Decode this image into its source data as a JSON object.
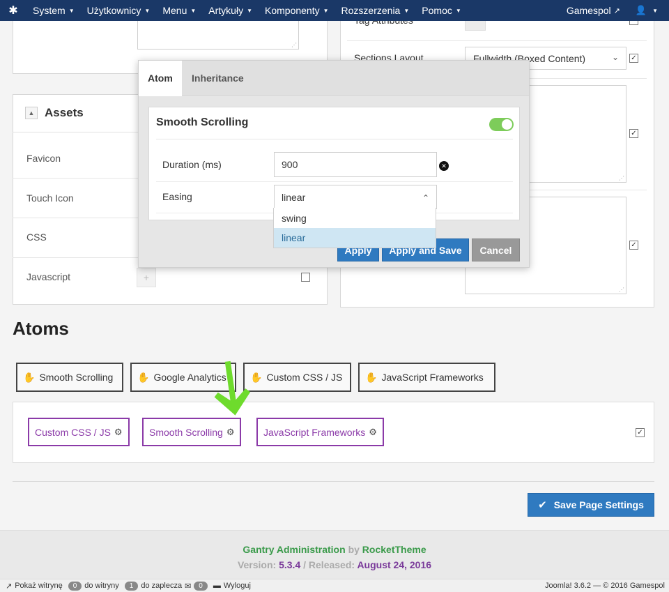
{
  "topnav": {
    "menu": [
      {
        "label": "System"
      },
      {
        "label": "Użytkownicy"
      },
      {
        "label": "Menu"
      },
      {
        "label": "Artykuły"
      },
      {
        "label": "Komponenty"
      },
      {
        "label": "Rozszerzenia"
      },
      {
        "label": "Pomoc"
      }
    ],
    "site_label": "Gamespol"
  },
  "background": {
    "tag_attributes_label": "Tag Attributes",
    "sections_layout_label": "Sections Layout",
    "sections_layout_value": "Fullwidth (Boxed Content)",
    "assets_title": "Assets",
    "assets": [
      {
        "label": "Favicon"
      },
      {
        "label": "Touch Icon"
      },
      {
        "label": "CSS"
      },
      {
        "label": "Javascript"
      }
    ]
  },
  "atoms": {
    "title": "Atoms",
    "available": [
      {
        "label": "Smooth Scrolling"
      },
      {
        "label": "Google Analytics"
      },
      {
        "label": "Custom CSS / JS"
      },
      {
        "label": "JavaScript Frameworks"
      }
    ],
    "enabled": [
      {
        "label": "Custom CSS / JS"
      },
      {
        "label": "Smooth Scrolling"
      },
      {
        "label": "JavaScript Frameworks"
      }
    ]
  },
  "save_page_label": "Save Page Settings",
  "footer": {
    "gantry_admin": "Gantry Administration",
    "by": "by",
    "rockettheme": "RocketTheme",
    "version_label": "Version:",
    "version": "5.3.4",
    "released_label": "/ Released:",
    "released": "August 24, 2016"
  },
  "statusbar": {
    "show_site": "Pokaż witrynę",
    "to_site_count": "0",
    "to_site": "do witryny",
    "to_admin_count": "1",
    "to_admin": "do zaplecza",
    "messages_count": "0",
    "logout": "Wyloguj",
    "right": "Joomla! 3.6.2 — © 2016 Gamespol"
  },
  "modal": {
    "tabs": [
      {
        "label": "Atom"
      },
      {
        "label": "Inheritance"
      }
    ],
    "title": "Smooth Scrolling",
    "enabled": true,
    "duration_label": "Duration (ms)",
    "duration_value": "900",
    "easing_label": "Easing",
    "easing_value": "linear",
    "easing_options": [
      {
        "label": "swing"
      },
      {
        "label": "linear"
      }
    ],
    "apply_label": "Apply",
    "apply_save_label": "Apply and Save",
    "cancel_label": "Cancel"
  }
}
